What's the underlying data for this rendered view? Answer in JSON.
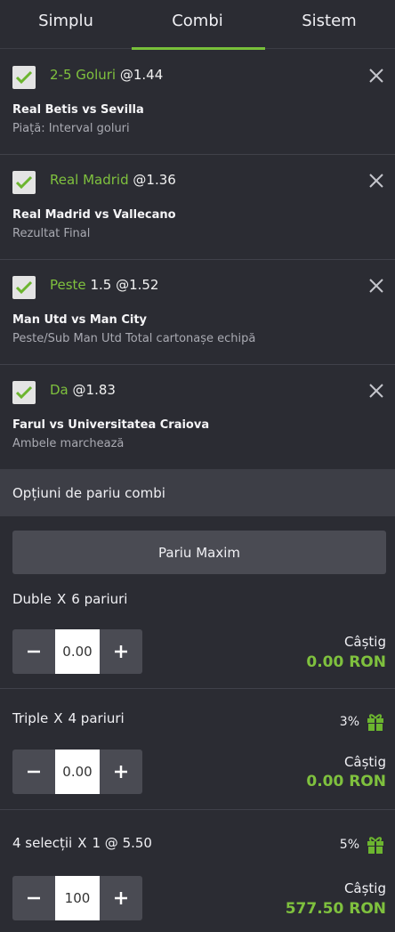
{
  "tabs": [
    {
      "label": "Simplu"
    },
    {
      "label": "Combi"
    },
    {
      "label": "Sistem"
    }
  ],
  "bets": [
    {
      "pick": "2-5 Goluri",
      "odds": "@1.44",
      "match": "Real Betis vs Sevilla",
      "market": "Piață: Interval goluri"
    },
    {
      "pick": "Real Madrid",
      "odds": "@1.36",
      "match": "Real Madrid vs Vallecano",
      "market": "Rezultat Final"
    },
    {
      "pick": "Peste",
      "odds": "1.5 @1.52",
      "match": "Man Utd vs Man City",
      "market": "Peste/Sub Man Utd Total cartonașe echipă"
    },
    {
      "pick": "Da",
      "odds": "@1.83",
      "match": "Farul vs Universitatea Craiova",
      "market": "Ambele marchează"
    }
  ],
  "options": {
    "header": "Opțiuni de pariu combi",
    "max_button": "Pariu Maxim"
  },
  "combos": [
    {
      "name": "Duble",
      "x": "X",
      "count": "6 pariuri",
      "bonus": "",
      "stake": "0.00",
      "win_label": "Câștig",
      "win_value": "0.00 RON"
    },
    {
      "name": "Triple",
      "x": "X",
      "count": "4 pariuri",
      "bonus": "3%",
      "stake": "0.00",
      "win_label": "Câștig",
      "win_value": "0.00 RON"
    },
    {
      "name": "4 selecții",
      "x": "X",
      "count": "1 @ 5.50",
      "bonus": "5%",
      "stake": "100",
      "win_label": "Câștig",
      "win_value": "577.50 RON"
    }
  ],
  "colors": {
    "accent": "#78c03a",
    "background": "#2b2c33",
    "header": "#3d3e46"
  }
}
